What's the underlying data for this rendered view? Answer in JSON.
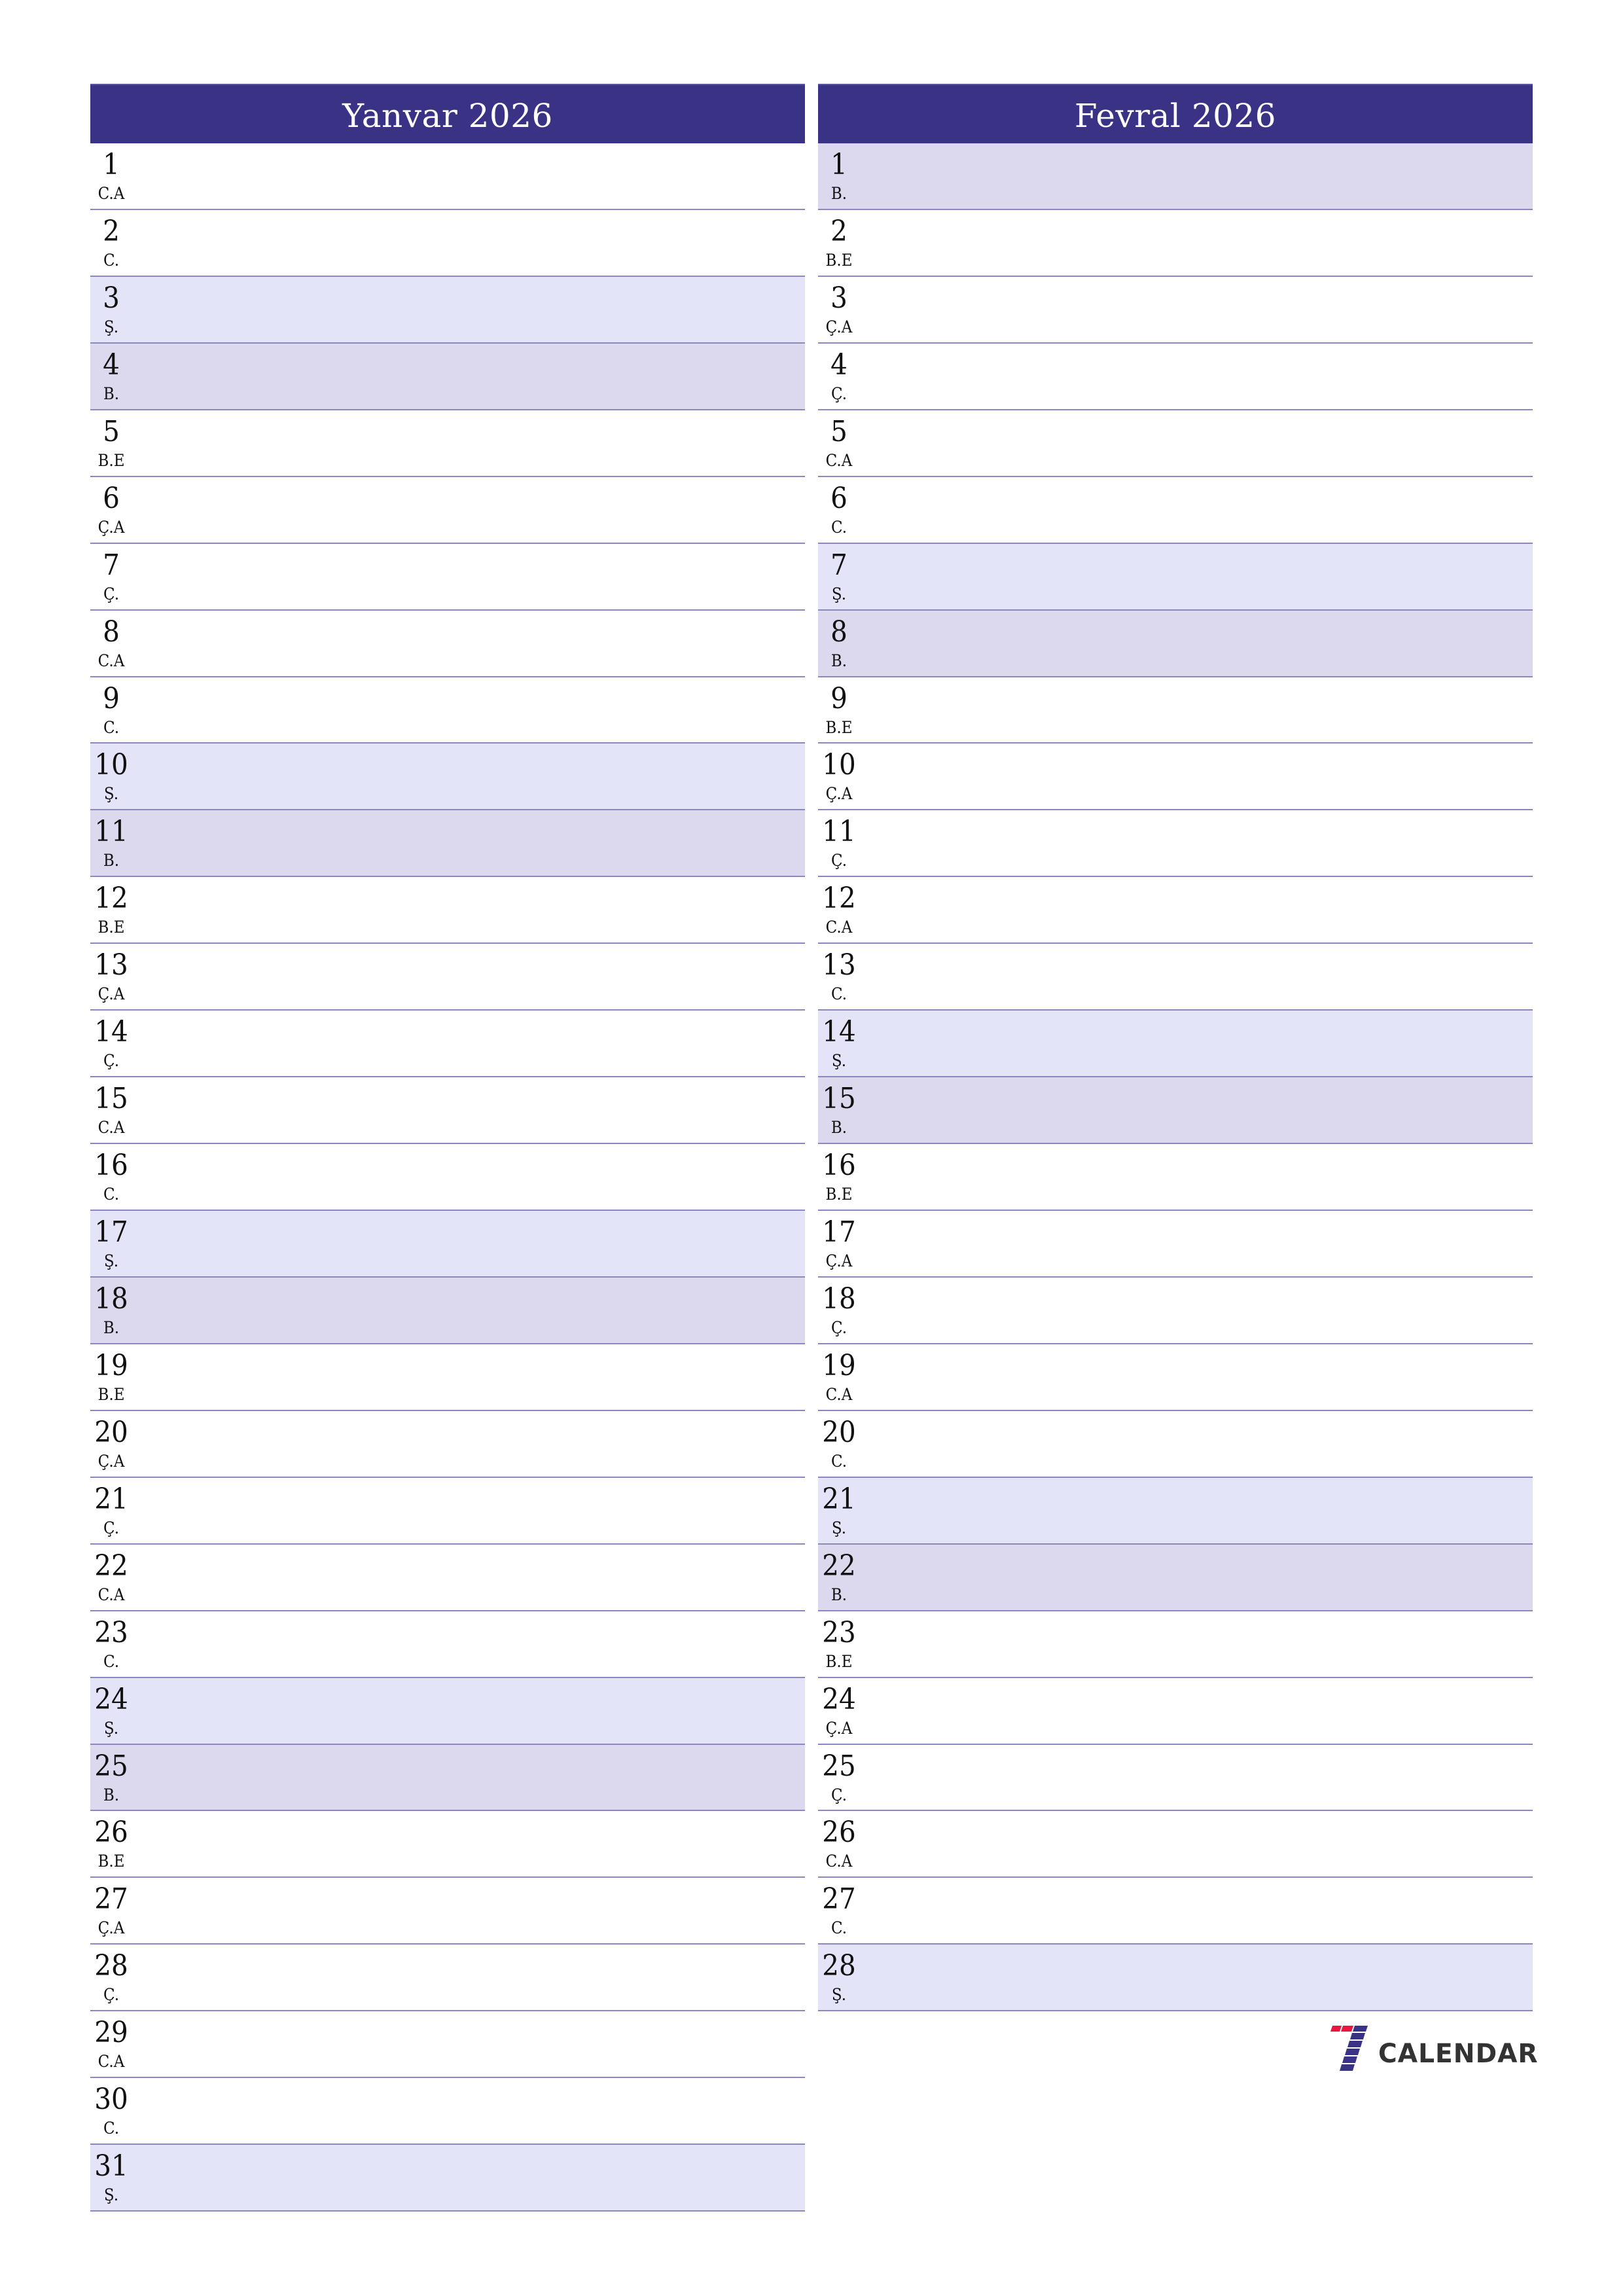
{
  "colors": {
    "header_bg": "#3a3284",
    "header_text": "#ffffff",
    "saturday_bg": "#e3e4f7",
    "sunday_bg": "#dcd8ee",
    "row_border": "#8b88bd",
    "logo_red": "#e8173f",
    "logo_blue": "#3a3284",
    "logo_text": "#333333"
  },
  "months": [
    {
      "title": "Yanvar 2026",
      "days": [
        {
          "num": "1",
          "wd": "C.A",
          "type": "weekday"
        },
        {
          "num": "2",
          "wd": "C.",
          "type": "weekday"
        },
        {
          "num": "3",
          "wd": "Ş.",
          "type": "sat"
        },
        {
          "num": "4",
          "wd": "B.",
          "type": "sun"
        },
        {
          "num": "5",
          "wd": "B.E",
          "type": "weekday"
        },
        {
          "num": "6",
          "wd": "Ç.A",
          "type": "weekday"
        },
        {
          "num": "7",
          "wd": "Ç.",
          "type": "weekday"
        },
        {
          "num": "8",
          "wd": "C.A",
          "type": "weekday"
        },
        {
          "num": "9",
          "wd": "C.",
          "type": "weekday"
        },
        {
          "num": "10",
          "wd": "Ş.",
          "type": "sat"
        },
        {
          "num": "11",
          "wd": "B.",
          "type": "sun"
        },
        {
          "num": "12",
          "wd": "B.E",
          "type": "weekday"
        },
        {
          "num": "13",
          "wd": "Ç.A",
          "type": "weekday"
        },
        {
          "num": "14",
          "wd": "Ç.",
          "type": "weekday"
        },
        {
          "num": "15",
          "wd": "C.A",
          "type": "weekday"
        },
        {
          "num": "16",
          "wd": "C.",
          "type": "weekday"
        },
        {
          "num": "17",
          "wd": "Ş.",
          "type": "sat"
        },
        {
          "num": "18",
          "wd": "B.",
          "type": "sun"
        },
        {
          "num": "19",
          "wd": "B.E",
          "type": "weekday"
        },
        {
          "num": "20",
          "wd": "Ç.A",
          "type": "weekday"
        },
        {
          "num": "21",
          "wd": "Ç.",
          "type": "weekday"
        },
        {
          "num": "22",
          "wd": "C.A",
          "type": "weekday"
        },
        {
          "num": "23",
          "wd": "C.",
          "type": "weekday"
        },
        {
          "num": "24",
          "wd": "Ş.",
          "type": "sat"
        },
        {
          "num": "25",
          "wd": "B.",
          "type": "sun"
        },
        {
          "num": "26",
          "wd": "B.E",
          "type": "weekday"
        },
        {
          "num": "27",
          "wd": "Ç.A",
          "type": "weekday"
        },
        {
          "num": "28",
          "wd": "Ç.",
          "type": "weekday"
        },
        {
          "num": "29",
          "wd": "C.A",
          "type": "weekday"
        },
        {
          "num": "30",
          "wd": "C.",
          "type": "weekday"
        },
        {
          "num": "31",
          "wd": "Ş.",
          "type": "sat"
        }
      ]
    },
    {
      "title": "Fevral 2026",
      "days": [
        {
          "num": "1",
          "wd": "B.",
          "type": "sun"
        },
        {
          "num": "2",
          "wd": "B.E",
          "type": "weekday"
        },
        {
          "num": "3",
          "wd": "Ç.A",
          "type": "weekday"
        },
        {
          "num": "4",
          "wd": "Ç.",
          "type": "weekday"
        },
        {
          "num": "5",
          "wd": "C.A",
          "type": "weekday"
        },
        {
          "num": "6",
          "wd": "C.",
          "type": "weekday"
        },
        {
          "num": "7",
          "wd": "Ş.",
          "type": "sat"
        },
        {
          "num": "8",
          "wd": "B.",
          "type": "sun"
        },
        {
          "num": "9",
          "wd": "B.E",
          "type": "weekday"
        },
        {
          "num": "10",
          "wd": "Ç.A",
          "type": "weekday"
        },
        {
          "num": "11",
          "wd": "Ç.",
          "type": "weekday"
        },
        {
          "num": "12",
          "wd": "C.A",
          "type": "weekday"
        },
        {
          "num": "13",
          "wd": "C.",
          "type": "weekday"
        },
        {
          "num": "14",
          "wd": "Ş.",
          "type": "sat"
        },
        {
          "num": "15",
          "wd": "B.",
          "type": "sun"
        },
        {
          "num": "16",
          "wd": "B.E",
          "type": "weekday"
        },
        {
          "num": "17",
          "wd": "Ç.A",
          "type": "weekday"
        },
        {
          "num": "18",
          "wd": "Ç.",
          "type": "weekday"
        },
        {
          "num": "19",
          "wd": "C.A",
          "type": "weekday"
        },
        {
          "num": "20",
          "wd": "C.",
          "type": "weekday"
        },
        {
          "num": "21",
          "wd": "Ş.",
          "type": "sat"
        },
        {
          "num": "22",
          "wd": "B.",
          "type": "sun"
        },
        {
          "num": "23",
          "wd": "B.E",
          "type": "weekday"
        },
        {
          "num": "24",
          "wd": "Ç.A",
          "type": "weekday"
        },
        {
          "num": "25",
          "wd": "Ç.",
          "type": "weekday"
        },
        {
          "num": "26",
          "wd": "C.A",
          "type": "weekday"
        },
        {
          "num": "27",
          "wd": "C.",
          "type": "weekday"
        },
        {
          "num": "28",
          "wd": "Ş.",
          "type": "sat"
        }
      ]
    }
  ],
  "logo": {
    "icon": "seven-logo-icon",
    "text": "CALENDAR"
  }
}
